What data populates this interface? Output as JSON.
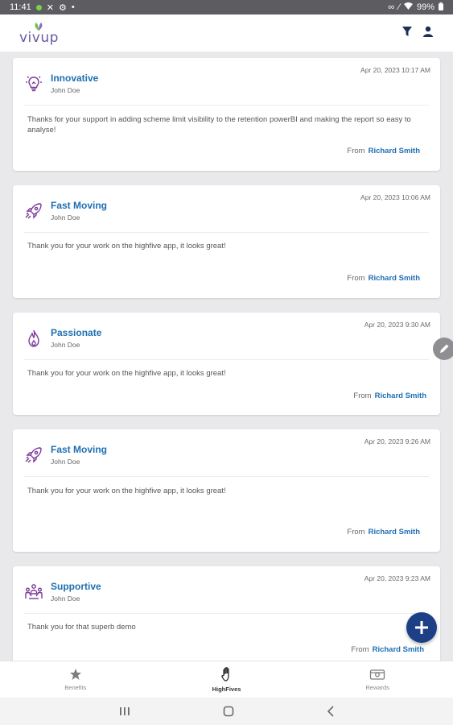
{
  "status_bar": {
    "time": "11:41",
    "battery": "99%"
  },
  "header": {
    "logo_text": "vivup"
  },
  "cards": [
    {
      "date": "Apr 20, 2023 10:17 AM",
      "value": "Innovative",
      "user": "John Doe",
      "message": "Thanks for your support in adding scheme limit visibility to the retention powerBI and making the report so easy to analyse!",
      "from_label": "From",
      "from_name": "Richard Smith",
      "icon": "lightbulb-icon"
    },
    {
      "date": "Apr 20, 2023 10:06 AM",
      "value": "Fast Moving",
      "user": "John Doe",
      "message": "Thank you for your work on the highfive app, it looks great!",
      "from_label": "From",
      "from_name": "Richard Smith",
      "icon": "rocket-icon"
    },
    {
      "date": "Apr 20, 2023 9:30 AM",
      "value": "Passionate",
      "user": "John Doe",
      "message": "Thank you for your work on the highfive app, it looks great!",
      "from_label": "From",
      "from_name": "Richard Smith",
      "icon": "flame-icon"
    },
    {
      "date": "Apr 20, 2023 9:26 AM",
      "value": "Fast Moving",
      "user": "John Doe",
      "message": "Thank you for your work on the highfive app, it looks great!",
      "from_label": "From",
      "from_name": "Richard Smith",
      "icon": "rocket-icon"
    },
    {
      "date": "Apr 20, 2023 9:23 AM",
      "value": "Supportive",
      "user": "John Doe",
      "message": "Thank you for that superb demo",
      "from_label": "From",
      "from_name": "Richard Smith",
      "icon": "support-people-icon"
    }
  ],
  "bottom_nav": {
    "items": [
      {
        "label": "Benefits",
        "icon": "star-icon"
      },
      {
        "label": "HighFives",
        "icon": "hand-icon"
      },
      {
        "label": "Rewards",
        "icon": "rewards-icon"
      }
    ]
  },
  "colors": {
    "accent": "#1f6fb2",
    "icon_purple": "#7b3a9c",
    "fab": "#1d3f86"
  }
}
